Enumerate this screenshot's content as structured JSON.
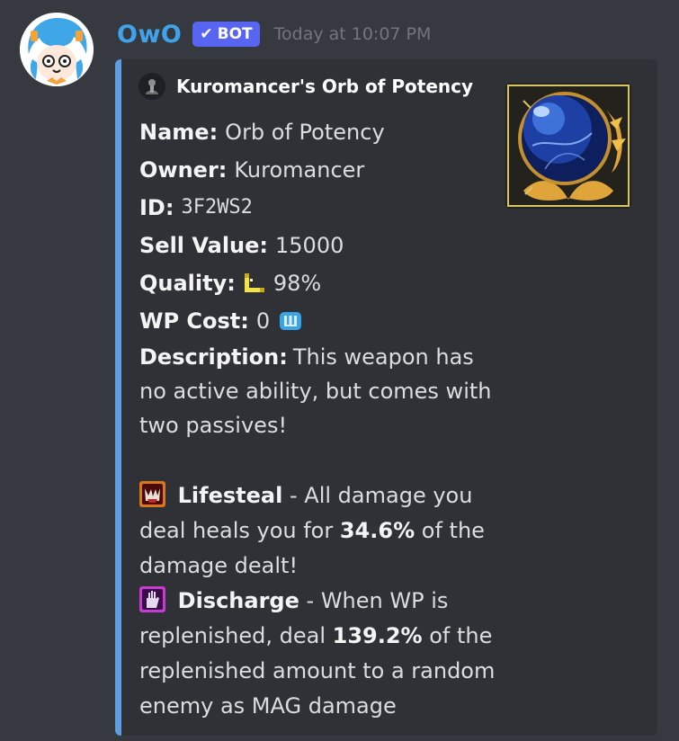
{
  "message": {
    "author": "OwO",
    "bot_label": "BOT",
    "timestamp": "Today at 10:07 PM",
    "colors": {
      "username": "#3fa3ec",
      "bot_tag": "#5865f2",
      "embed_accent": "#5d9ee3",
      "background": "#36393f",
      "embed_background": "#2f3136"
    }
  },
  "embed": {
    "author_name": "Kuromancer's Orb of Potency",
    "fields": {
      "name_label": "Name:",
      "name_value": "Orb of Potency",
      "owner_label": "Owner:",
      "owner_value": "Kuromancer",
      "id_label": "ID:",
      "id_value": "3F2WS2",
      "sell_label": "Sell Value:",
      "sell_value": "15000",
      "quality_label": "Quality:",
      "quality_value": "98%",
      "quality_icon": "legendary-quality-icon",
      "wp_label": "WP Cost:",
      "wp_value": "0",
      "wp_icon": "weapon-points-icon",
      "desc_label": "Description:",
      "desc_value": "This weapon has no active ability, but comes with two passives!"
    },
    "passives": [
      {
        "icon": "lifesteal-icon",
        "name": "Lifesteal",
        "sep": "-",
        "text_before": "All damage you deal heals you for",
        "percent": "34.6%",
        "text_after": "of the damage dealt!"
      },
      {
        "icon": "discharge-icon",
        "name": "Discharge",
        "sep": "-",
        "text_before": "When WP is replenished, deal",
        "percent": "139.2%",
        "text_after": "of the replenished amount to a random enemy as MAG damage"
      }
    ],
    "thumbnail": "orb-of-potency-image"
  }
}
